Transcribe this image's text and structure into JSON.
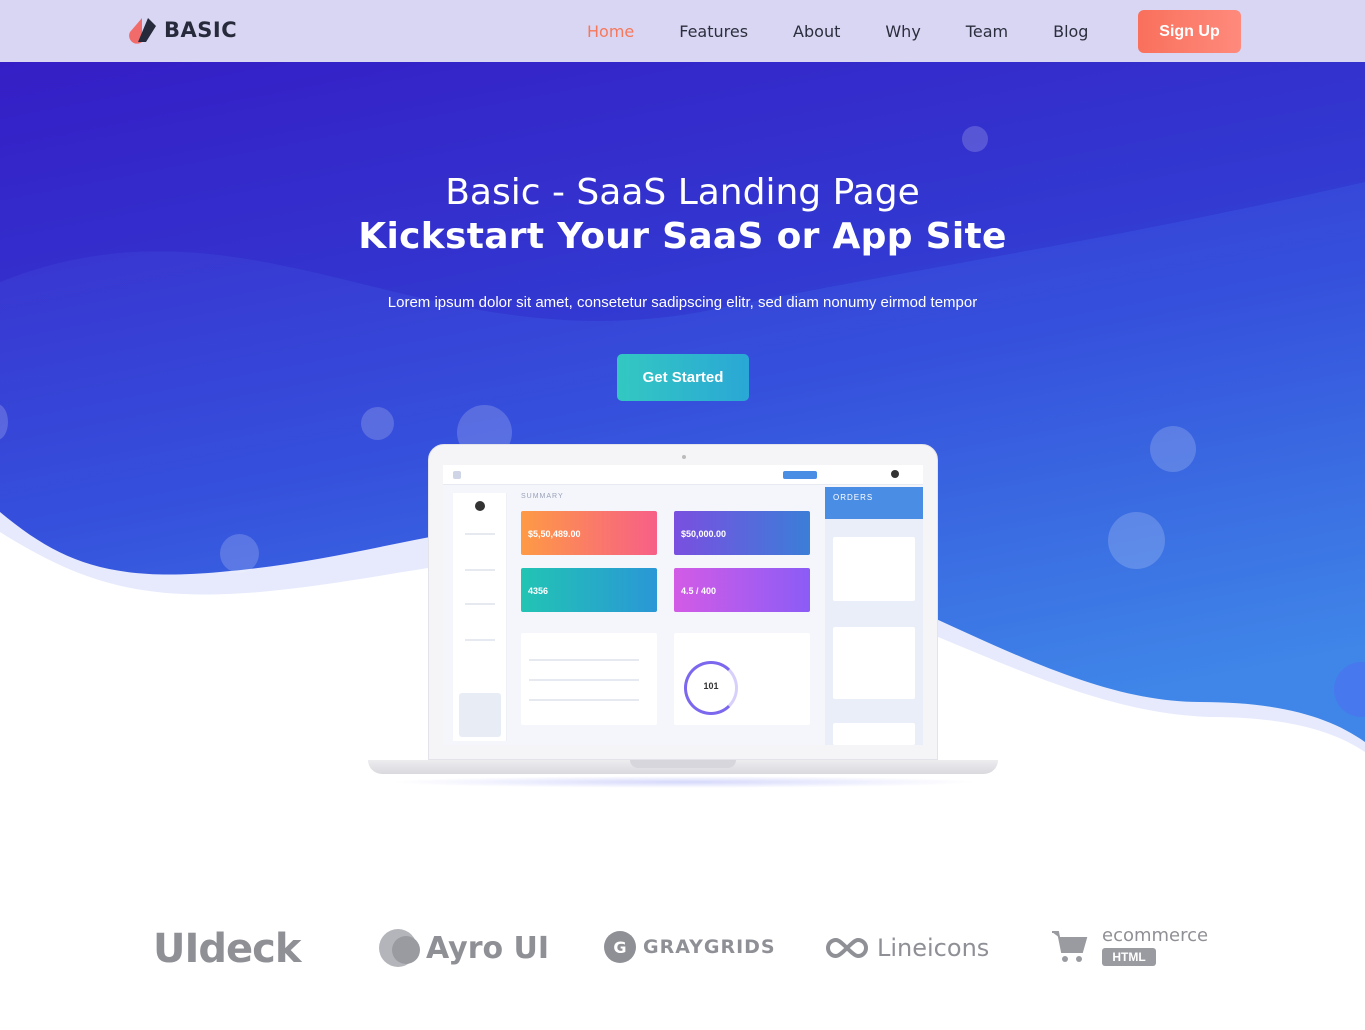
{
  "nav": {
    "brand": "BASIC",
    "links": [
      {
        "label": "Home",
        "active": true
      },
      {
        "label": "Features"
      },
      {
        "label": "About"
      },
      {
        "label": "Why"
      },
      {
        "label": "Team"
      },
      {
        "label": "Blog"
      }
    ],
    "signup_label": "Sign Up"
  },
  "hero": {
    "title_line1": "Basic - SaaS Landing Page",
    "title_line2": "Kickstart Your SaaS or App Site",
    "subtitle": "Lorem ipsum dolor sit amet, consetetur sadipscing elitr, sed diam nonumy eirmod tempor",
    "cta_label": "Get Started"
  },
  "dashboard": {
    "summary_label": "SUMMARY",
    "cards": [
      {
        "value": "$5,50,489.00"
      },
      {
        "value": "$50,000.00"
      },
      {
        "value": "4356"
      },
      {
        "value": "4.5 / 400"
      }
    ],
    "orders_title": "ORDERS",
    "insight_value": "101"
  },
  "brands": [
    {
      "name": "UIdeck"
    },
    {
      "name": "Ayro UI"
    },
    {
      "name": "GRAYGRIDS"
    },
    {
      "name": "Lineicons"
    },
    {
      "name": "ecommerce",
      "badge": "HTML"
    }
  ],
  "colors": {
    "hero_top": "#3a22c8",
    "hero_bottom": "#3f7fe6",
    "accent": "#f7775a",
    "cta": "#33c8c2",
    "nav_bg": "#d9d6f3"
  }
}
